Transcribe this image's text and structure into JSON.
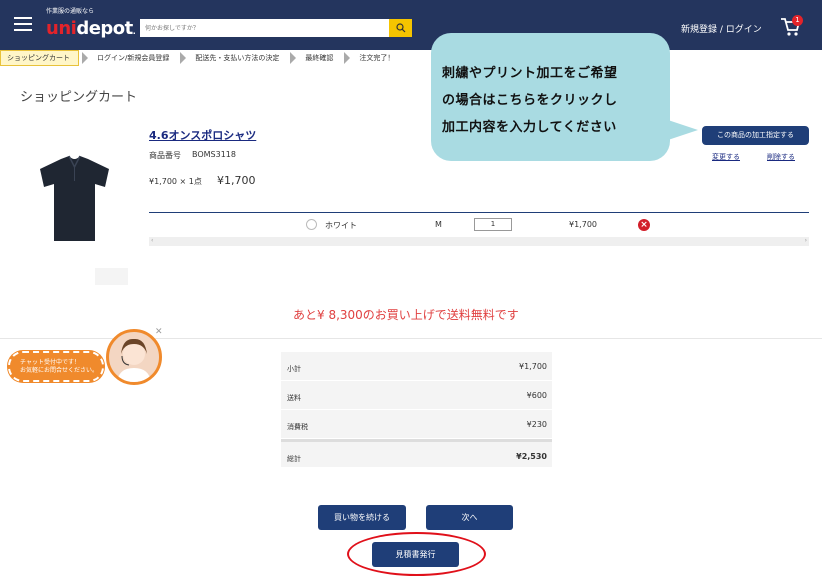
{
  "header": {
    "tagline": "作業服の通販なら",
    "logo_prefix": "uni",
    "logo_suffix": "depot",
    "search_placeholder": "何かお探しですか？",
    "login_label": "新規登録 / ログイン",
    "cart_count": "1"
  },
  "breadcrumb": [
    "ショッピングカート",
    "ログイン/新規会員登録",
    "配送先・支払い方法の決定",
    "最終確認",
    "注文完了！"
  ],
  "page_title": "ショッピングカート",
  "product": {
    "name": "4.6オンスポロシャツ",
    "code_label": "商品番号",
    "code": "BOMS3118",
    "price_line": "¥1,700 × 1点",
    "price": "¥1,700",
    "customize_label": "この商品の加工指定する",
    "change_label": "変更する",
    "delete_label": "削除する",
    "color": "ホワイト",
    "size": "M",
    "quantity": "1",
    "line_price": "¥1,700"
  },
  "free_shipping_message": "あと¥ 8,300のお買い上げで送料無料です",
  "chat": {
    "line1": "チャット受付中です！",
    "line2": "お気軽にお問合せください。"
  },
  "summary": {
    "subtotal_label": "小計",
    "subtotal": "¥1,700",
    "shipping_label": "送料",
    "shipping": "¥600",
    "tax_label": "消費税",
    "tax": "¥230",
    "total_label": "総計",
    "total": "¥2,530"
  },
  "buttons": {
    "continue": "買い物を続ける",
    "next": "次へ",
    "estimate": "見積書発行"
  },
  "callout": {
    "line1": "刺繍やプリント加工をご希望",
    "line2": "の場合はこちらをクリックし",
    "line3": "加工内容を入力してください"
  },
  "colors": {
    "header": "#24355e",
    "accent_button": "#1f3e78",
    "brand_red": "#e3232a",
    "callout": "#a9dbe2",
    "chat": "#f08a2c"
  }
}
